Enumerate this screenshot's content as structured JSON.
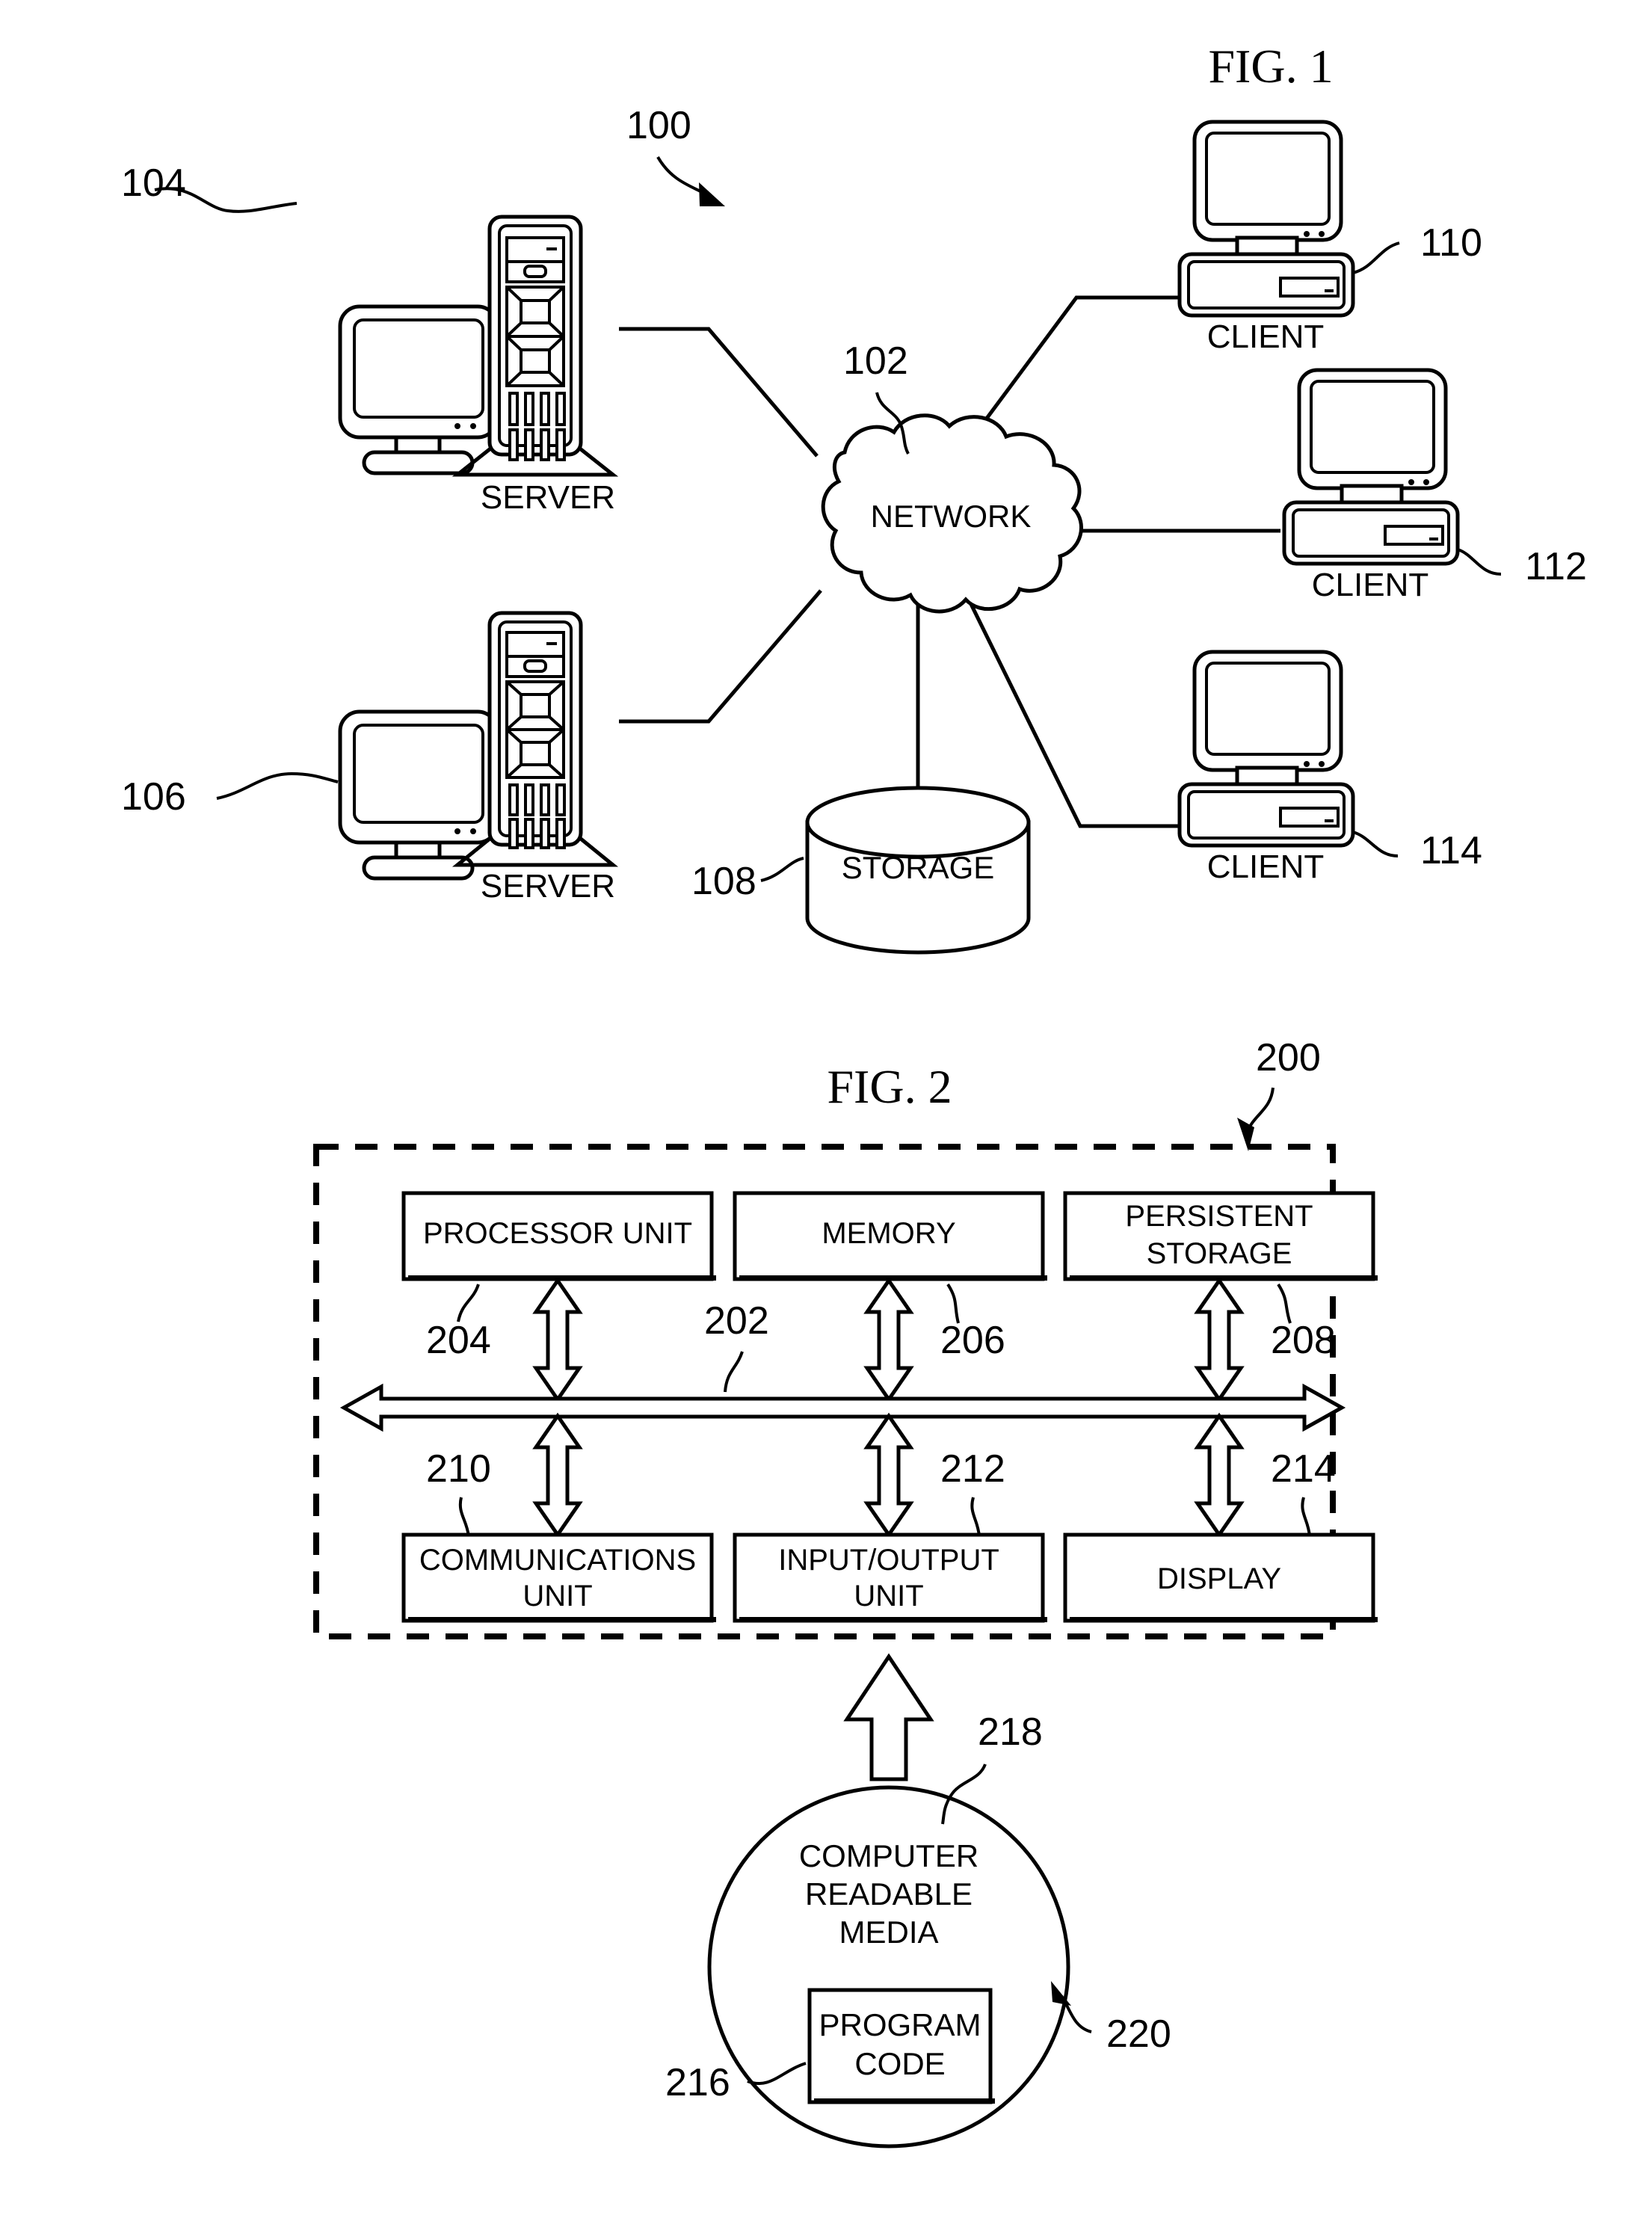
{
  "figures": [
    {
      "id": "fig1",
      "title": "FIG. 1",
      "ref": "100",
      "nodes": {
        "network": {
          "label": "NETWORK",
          "ref": "102"
        },
        "storage": {
          "label": "STORAGE",
          "ref": "108"
        },
        "server_top": {
          "label": "SERVER",
          "ref": "104"
        },
        "server_bottom": {
          "label": "SERVER",
          "ref": "106"
        },
        "client_top": {
          "label": "CLIENT",
          "ref": "110"
        },
        "client_middle": {
          "label": "CLIENT",
          "ref": "112"
        },
        "client_bottom": {
          "label": "CLIENT",
          "ref": "114"
        }
      }
    },
    {
      "id": "fig2",
      "title": "FIG. 2",
      "ref": "200",
      "bus_ref": "202",
      "blocks_top": [
        {
          "label": "PROCESSOR UNIT",
          "ref": "204",
          "lines": [
            "PROCESSOR UNIT"
          ]
        },
        {
          "label": "MEMORY",
          "ref": "206",
          "lines": [
            "MEMORY"
          ]
        },
        {
          "label": "PERSISTENT STORAGE",
          "ref": "208",
          "lines": [
            "PERSISTENT",
            "STORAGE"
          ]
        }
      ],
      "blocks_bottom": [
        {
          "label": "COMMUNICATIONS UNIT",
          "ref": "210",
          "lines": [
            "COMMUNICATIONS",
            "UNIT"
          ]
        },
        {
          "label": "INPUT/OUTPUT UNIT",
          "ref": "212",
          "lines": [
            "INPUT/OUTPUT",
            "UNIT"
          ]
        },
        {
          "label": "DISPLAY",
          "ref": "214",
          "lines": [
            "DISPLAY"
          ]
        }
      ],
      "media": {
        "lines": [
          "COMPUTER",
          "READABLE",
          "MEDIA"
        ],
        "ref_media": "218",
        "ref_product": "220",
        "program_code": {
          "lines": [
            "PROGRAM",
            "CODE"
          ],
          "ref": "216"
        }
      }
    }
  ],
  "labels": {
    "fig1_title": "FIG. 1",
    "fig1_ref": "100",
    "network": "NETWORK",
    "network_ref": "102",
    "storage": "STORAGE",
    "storage_ref": "108",
    "server_a": "SERVER",
    "server_a_ref": "104",
    "server_b": "SERVER",
    "server_b_ref": "106",
    "client_a": "CLIENT",
    "client_a_ref": "110",
    "client_b": "CLIENT",
    "client_b_ref": "112",
    "client_c": "CLIENT",
    "client_c_ref": "114",
    "fig2_title": "FIG. 2",
    "fig2_ref": "200",
    "bus_ref": "202",
    "processor_unit": "PROCESSOR UNIT",
    "processor_unit_ref": "204",
    "memory": "MEMORY",
    "memory_ref": "206",
    "persistent_1": "PERSISTENT",
    "persistent_2": "STORAGE",
    "persistent_ref": "208",
    "communications_1": "COMMUNICATIONS",
    "communications_2": "UNIT",
    "communications_ref": "210",
    "io_1": "INPUT/OUTPUT",
    "io_2": "UNIT",
    "io_ref": "212",
    "display": "DISPLAY",
    "display_ref": "214",
    "media_1": "COMPUTER",
    "media_2": "READABLE",
    "media_3": "MEDIA",
    "media_ref": "218",
    "product_ref": "220",
    "program_1": "PROGRAM",
    "program_2": "CODE",
    "program_ref": "216"
  },
  "colors": {
    "ink": "#000000",
    "paper": "#ffffff"
  }
}
